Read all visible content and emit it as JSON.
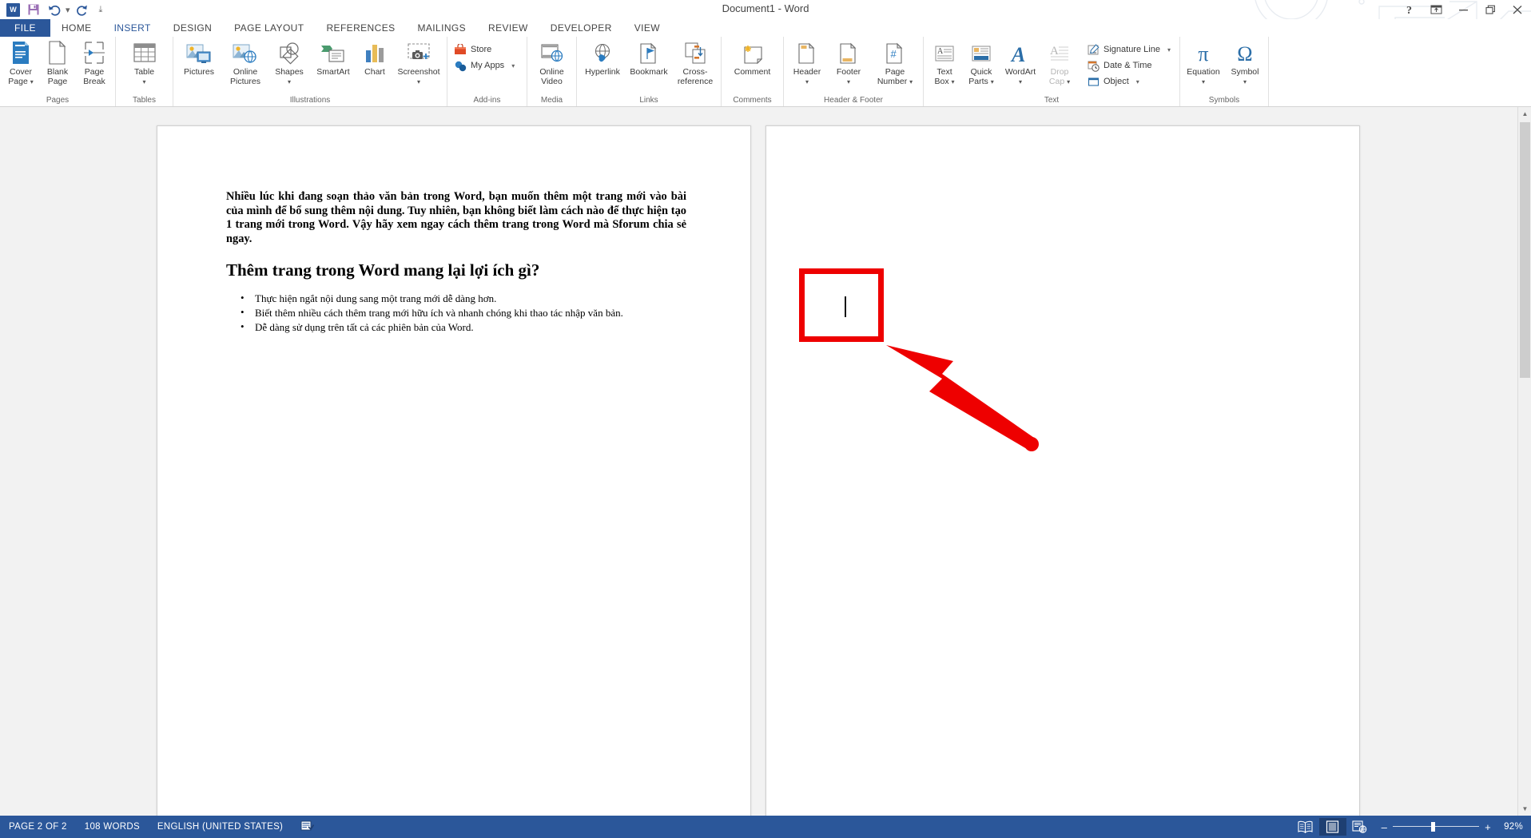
{
  "window": {
    "title": "Document1 - Word",
    "quick_access": [
      {
        "name": "word-logo",
        "label": "W"
      },
      {
        "name": "save-icon",
        "label": "Save"
      },
      {
        "name": "undo-icon",
        "label": "Undo"
      },
      {
        "name": "redo-icon",
        "label": "Redo"
      },
      {
        "name": "customize-qat-icon",
        "label": "Customize Quick Access Toolbar"
      }
    ],
    "controls": [
      {
        "name": "help-button",
        "glyph": "?"
      },
      {
        "name": "ribbon-display-options-button",
        "glyph": "ribbon"
      },
      {
        "name": "minimize-button",
        "glyph": "–"
      },
      {
        "name": "restore-button",
        "glyph": "❐"
      },
      {
        "name": "close-button",
        "glyph": "✕"
      }
    ],
    "account_warning": "!",
    "accent_color": "#2b579a"
  },
  "tabs": [
    {
      "label": "FILE",
      "active": false,
      "file": true
    },
    {
      "label": "HOME",
      "active": false
    },
    {
      "label": "INSERT",
      "active": true
    },
    {
      "label": "DESIGN",
      "active": false
    },
    {
      "label": "PAGE LAYOUT",
      "active": false
    },
    {
      "label": "REFERENCES",
      "active": false
    },
    {
      "label": "MAILINGS",
      "active": false
    },
    {
      "label": "REVIEW",
      "active": false
    },
    {
      "label": "DEVELOPER",
      "active": false
    },
    {
      "label": "VIEW",
      "active": false
    }
  ],
  "ribbon": {
    "groups": [
      {
        "label": "Pages",
        "buttons": [
          {
            "name": "cover-page-button",
            "line1": "Cover",
            "line2": "Page",
            "caret": true,
            "icon": "cover-page-icon"
          },
          {
            "name": "blank-page-button",
            "line1": "Blank",
            "line2": "Page",
            "caret": false,
            "icon": "blank-page-icon"
          },
          {
            "name": "page-break-button",
            "line1": "Page",
            "line2": "Break",
            "caret": false,
            "icon": "page-break-icon"
          }
        ]
      },
      {
        "label": "Tables",
        "buttons": [
          {
            "name": "table-button",
            "line1": "Table",
            "line2": "",
            "caret": true,
            "icon": "table-icon"
          }
        ]
      },
      {
        "label": "Illustrations",
        "buttons": [
          {
            "name": "pictures-button",
            "line1": "Pictures",
            "line2": "",
            "caret": false,
            "icon": "pictures-icon"
          },
          {
            "name": "online-pictures-button",
            "line1": "Online",
            "line2": "Pictures",
            "caret": false,
            "icon": "online-pictures-icon"
          },
          {
            "name": "shapes-button",
            "line1": "Shapes",
            "line2": "",
            "caret": true,
            "icon": "shapes-icon"
          },
          {
            "name": "smartart-button",
            "line1": "SmartArt",
            "line2": "",
            "caret": false,
            "icon": "smartart-icon"
          },
          {
            "name": "chart-button",
            "line1": "Chart",
            "line2": "",
            "caret": false,
            "icon": "chart-icon"
          },
          {
            "name": "screenshot-button",
            "line1": "Screenshot",
            "line2": "",
            "caret": true,
            "icon": "screenshot-icon"
          }
        ]
      },
      {
        "label": "Add-ins",
        "small_buttons": [
          {
            "name": "store-button",
            "label": "Store",
            "icon": "store-icon",
            "caret": false
          },
          {
            "name": "my-apps-button",
            "label": "My Apps",
            "icon": "my-apps-icon",
            "caret": true
          }
        ]
      },
      {
        "label": "Media",
        "buttons": [
          {
            "name": "online-video-button",
            "line1": "Online",
            "line2": "Video",
            "caret": false,
            "icon": "online-video-icon"
          }
        ]
      },
      {
        "label": "Links",
        "buttons": [
          {
            "name": "hyperlink-button",
            "line1": "Hyperlink",
            "line2": "",
            "caret": false,
            "icon": "hyperlink-icon"
          },
          {
            "name": "bookmark-button",
            "line1": "Bookmark",
            "line2": "",
            "caret": false,
            "icon": "bookmark-icon"
          },
          {
            "name": "cross-reference-button",
            "line1": "Cross-",
            "line2": "reference",
            "caret": false,
            "icon": "cross-reference-icon"
          }
        ]
      },
      {
        "label": "Comments",
        "buttons": [
          {
            "name": "comment-button",
            "line1": "Comment",
            "line2": "",
            "caret": false,
            "icon": "comment-icon"
          }
        ]
      },
      {
        "label": "Header & Footer",
        "buttons": [
          {
            "name": "header-button",
            "line1": "Header",
            "line2": "",
            "caret": true,
            "icon": "header-icon"
          },
          {
            "name": "footer-button",
            "line1": "Footer",
            "line2": "",
            "caret": true,
            "icon": "footer-icon"
          },
          {
            "name": "page-number-button",
            "line1": "Page",
            "line2": "Number",
            "caret": true,
            "icon": "page-number-icon"
          }
        ]
      },
      {
        "label": "Text",
        "buttons": [
          {
            "name": "text-box-button",
            "line1": "Text",
            "line2": "Box",
            "caret": true,
            "icon": "text-box-icon"
          },
          {
            "name": "quick-parts-button",
            "line1": "Quick",
            "line2": "Parts",
            "caret": true,
            "icon": "quick-parts-icon"
          },
          {
            "name": "wordart-button",
            "line1": "WordArt",
            "line2": "",
            "caret": true,
            "icon": "wordart-icon"
          },
          {
            "name": "drop-cap-button",
            "line1": "Drop",
            "line2": "Cap",
            "caret": true,
            "icon": "drop-cap-icon",
            "disabled": true
          }
        ],
        "small_buttons": [
          {
            "name": "signature-line-button",
            "label": "Signature Line",
            "icon": "signature-line-icon",
            "caret": true
          },
          {
            "name": "date-and-time-button",
            "label": "Date & Time",
            "icon": "date-time-icon",
            "caret": false
          },
          {
            "name": "object-button",
            "label": "Object",
            "icon": "object-icon",
            "caret": true
          }
        ]
      },
      {
        "label": "Symbols",
        "buttons": [
          {
            "name": "equation-button",
            "line1": "Equation",
            "line2": "",
            "caret": true,
            "icon": "equation-icon",
            "glyph": "π"
          },
          {
            "name": "symbol-button",
            "line1": "Symbol",
            "line2": "",
            "caret": true,
            "icon": "symbol-icon",
            "glyph": "Ω"
          }
        ]
      }
    ]
  },
  "document": {
    "paragraph": "Nhiều lúc khi đang soạn thảo văn bản trong Word, bạn muốn thêm một trang mới vào bài của mình để bổ sung thêm nội dung. Tuy nhiên, bạn không biết làm cách nào để thực hiện tạo 1 trang mới trong Word. Vậy hãy xem ngay cách thêm trang trong Word mà Sforum chia sẻ ngay.",
    "heading": "Thêm trang trong Word mang lại lợi ích gì?",
    "bullets": [
      "Thực hiện ngắt nội dung sang một trang mới dễ dàng hơn.",
      "Biết thêm nhiều cách thêm trang mới hữu ích và nhanh chóng khi thao tác nhập văn bản.",
      "Dễ dàng sử dụng trên tất cả các phiên bản của Word."
    ]
  },
  "annotation": {
    "box_color": "#ee0000",
    "arrow_color": "#ee0000",
    "box_name": "red-highlight-box",
    "arrow_name": "red-arrow-pointer"
  },
  "status_bar": {
    "page_info": "PAGE 2 OF 2",
    "word_count": "108 WORDS",
    "language": "ENGLISH (UNITED STATES)",
    "proofing_icon": "proofing-errors-icon",
    "views": [
      {
        "name": "read-mode-button",
        "label": "Read Mode",
        "active": false
      },
      {
        "name": "print-layout-button",
        "label": "Print Layout",
        "active": true
      },
      {
        "name": "web-layout-button",
        "label": "Web Layout",
        "active": false
      }
    ],
    "zoom_out_label": "–",
    "zoom_in_label": "+",
    "zoom_level": "92%"
  }
}
